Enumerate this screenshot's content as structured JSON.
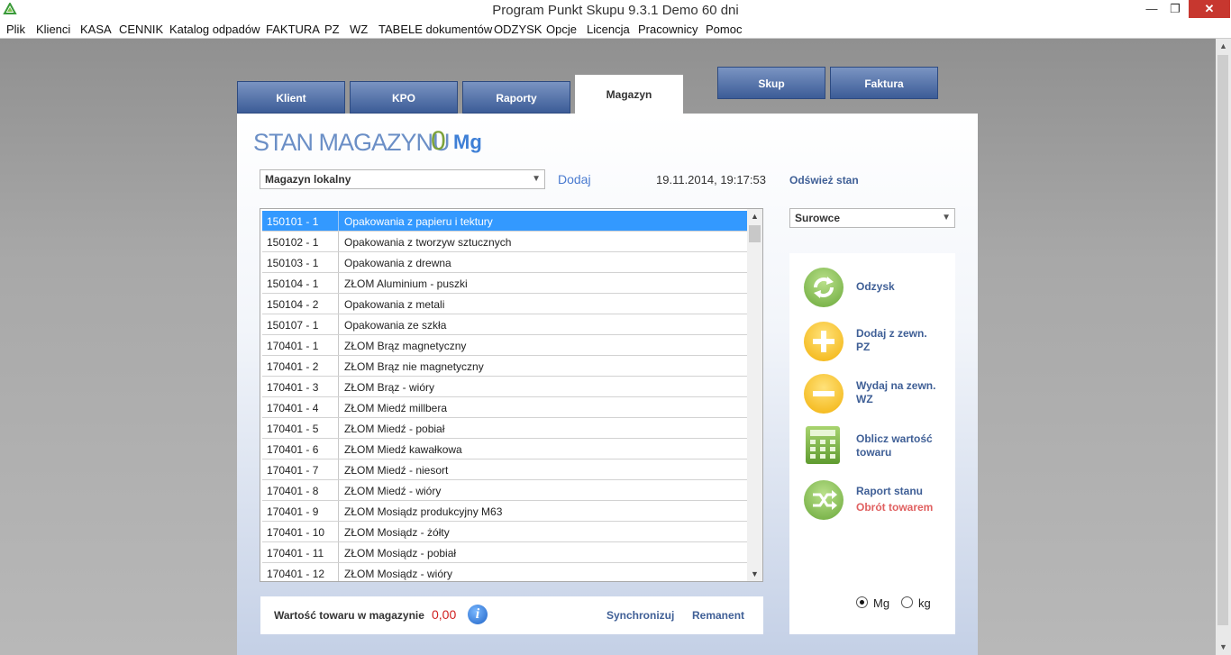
{
  "window": {
    "title": "Program Punkt Skupu 9.3.1   Demo 60 dni",
    "minimize": "—",
    "maximize": "❐",
    "close": "✕"
  },
  "menu": [
    "Plik",
    "Klienci",
    "KASA",
    "CENNIK",
    "Katalog odpadów",
    "FAKTURA",
    "PZ",
    "WZ",
    "TABELE dokumentów",
    "ODZYSK",
    "Opcje",
    "Licencja",
    "Pracownicy",
    "Pomoc"
  ],
  "tabs": [
    "Klient",
    "KPO",
    "Raporty",
    "Magazyn"
  ],
  "active_tab": "Magazyn",
  "top_buttons": [
    "Skup",
    "Faktura"
  ],
  "heading": {
    "title": "STAN MAGAZYNU",
    "value": "0",
    "unit": "Mg"
  },
  "warehouse_select": {
    "value": "Magazyn lokalny"
  },
  "add_link": "Dodaj",
  "datetime": "19.11.2014, 19:17:53",
  "refresh_link": "Odśwież stan",
  "category_select": {
    "value": "Surowce"
  },
  "items": [
    {
      "code": "150101 - 1",
      "name": "Opakowania z papieru i tektury",
      "selected": true
    },
    {
      "code": "150102 - 1",
      "name": "Opakowania z tworzyw sztucznych"
    },
    {
      "code": "150103 - 1",
      "name": "Opakowania z drewna"
    },
    {
      "code": "150104 - 1",
      "name": "ZŁOM Aluminium - puszki"
    },
    {
      "code": "150104 - 2",
      "name": "Opakowania z metali"
    },
    {
      "code": "150107 - 1",
      "name": "Opakowania ze szkła"
    },
    {
      "code": "170401 - 1",
      "name": "ZŁOM Brąz magnetyczny"
    },
    {
      "code": "170401 - 2",
      "name": "ZŁOM Brąz nie magnetyczny"
    },
    {
      "code": "170401 - 3",
      "name": "ZŁOM Brąz - wióry"
    },
    {
      "code": "170401 - 4",
      "name": "ZŁOM Miedź millbera"
    },
    {
      "code": "170401 - 5",
      "name": "ZŁOM Miedź - pobiał"
    },
    {
      "code": "170401 - 6",
      "name": "ZŁOM Miedź kawałkowa"
    },
    {
      "code": "170401 - 7",
      "name": "ZŁOM Miedź - niesort"
    },
    {
      "code": "170401 - 8",
      "name": "ZŁOM Miedź - wióry"
    },
    {
      "code": "170401 - 9",
      "name": "ZŁOM Mosiądz produkcyjny M63"
    },
    {
      "code": "170401 - 10",
      "name": "ZŁOM Mosiądz - żółty"
    },
    {
      "code": "170401 - 11",
      "name": "ZŁOM Mosiądz - pobiał"
    },
    {
      "code": "170401 - 12",
      "name": "ZŁOM Mosiądz - wióry"
    }
  ],
  "footer": {
    "label": "Wartość towaru w magazynie",
    "value": "0,00",
    "info": "i",
    "sync": "Synchronizuj",
    "remanent": "Remanent"
  },
  "actions": {
    "odzysk": "Odzysk",
    "dodaj_pz": [
      "Dodaj z zewn.",
      "PZ"
    ],
    "wydaj_wz": [
      "Wydaj na zewn.",
      "WZ"
    ],
    "oblicz": [
      "Oblicz wartość",
      "towaru"
    ],
    "raport": "Raport stanu",
    "obrot": "Obrót towarem"
  },
  "units": {
    "options": [
      "Mg",
      "kg"
    ],
    "selected": "Mg"
  },
  "colors": {
    "tab": "#3c5c97",
    "link": "#3f5f96",
    "heading": "#6b8fc6",
    "value_green": "#7da23a",
    "selection": "#3399ff",
    "red": "#d02020"
  },
  "icons": {
    "app": "recycle-icon",
    "odzysk": "recycle-arrows-icon",
    "pz": "plus-icon",
    "wz": "minus-icon",
    "calc": "calculator-icon",
    "report": "shuffle-icon",
    "info": "info-icon"
  }
}
